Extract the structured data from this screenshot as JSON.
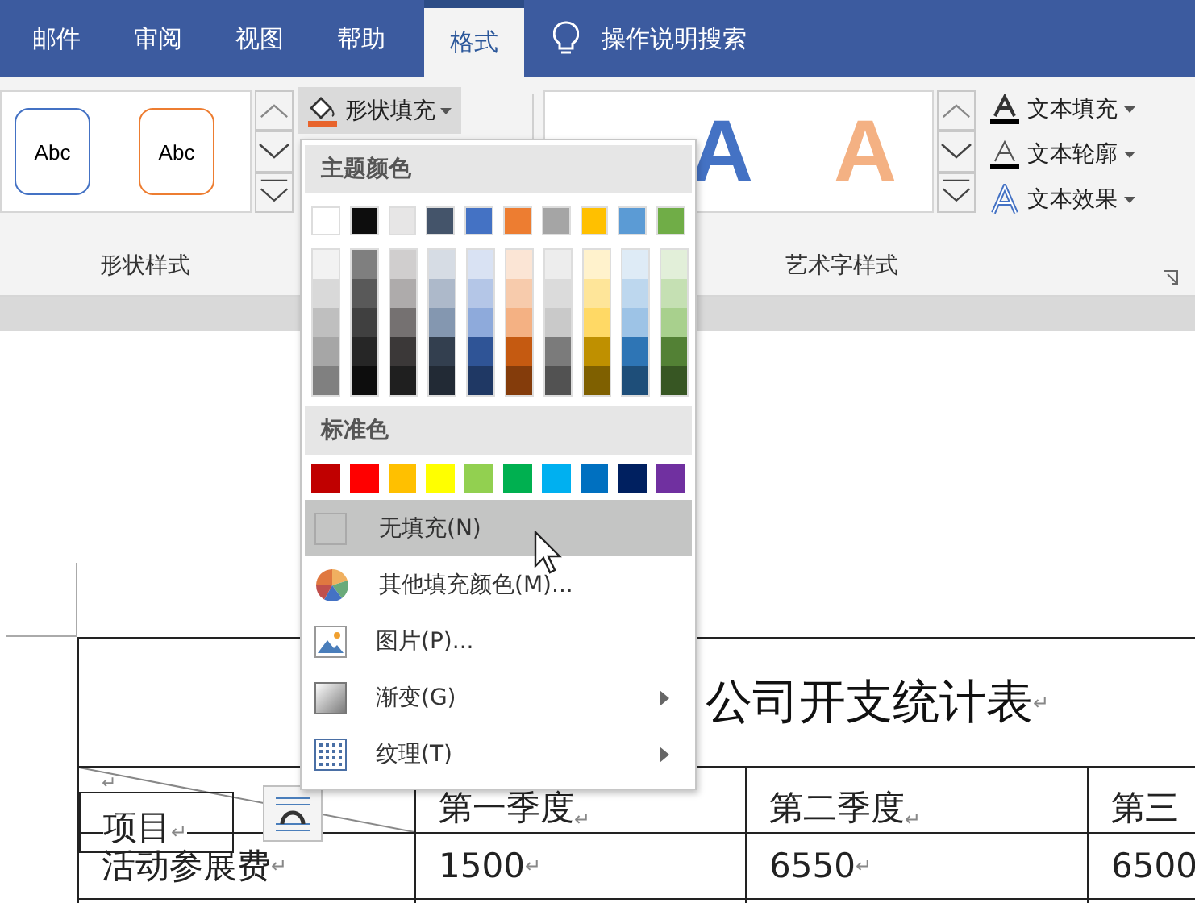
{
  "tabs": [
    {
      "label": "邮件",
      "selected": false
    },
    {
      "label": "审阅",
      "selected": false
    },
    {
      "label": "视图",
      "selected": false
    },
    {
      "label": "帮助",
      "selected": false
    },
    {
      "label": "格式",
      "selected": true
    }
  ],
  "search": {
    "label": "操作说明搜索"
  },
  "shape_styles": {
    "label": "形状样式",
    "styles": [
      {
        "text": "Abc",
        "color": "#4472c4"
      },
      {
        "text": "Abc",
        "color": "#ed7d31"
      }
    ],
    "fill_button": {
      "label": "形状填充"
    }
  },
  "wordart_styles": {
    "label": "艺术字样式",
    "samples": [
      {
        "text": "A",
        "color": "#4472c4"
      },
      {
        "text": "A",
        "color": "#f4b183"
      }
    ],
    "commands": [
      {
        "label": "文本填充",
        "kind": "fill"
      },
      {
        "label": "文本轮廓",
        "kind": "outline"
      },
      {
        "label": "文本效果",
        "kind": "effects"
      }
    ]
  },
  "fill_menu": {
    "theme_header": "主题颜色",
    "theme_colors": [
      {
        "color": "#ffffff",
        "shades": [
          {
            "color": "#f2f2f2"
          },
          {
            "color": "#d9d9d9"
          },
          {
            "color": "#bfbfbf"
          },
          {
            "color": "#a6a6a6"
          },
          {
            "color": "#808080"
          }
        ]
      },
      {
        "color": "#0d0d0d",
        "shades": [
          {
            "color": "#7f7f7f"
          },
          {
            "color": "#595959"
          },
          {
            "color": "#404040"
          },
          {
            "color": "#262626"
          },
          {
            "color": "#0d0d0d"
          }
        ]
      },
      {
        "color": "#e7e6e6",
        "shades": [
          {
            "color": "#d0cece"
          },
          {
            "color": "#aeabab"
          },
          {
            "color": "#757171"
          },
          {
            "color": "#3b3838"
          },
          {
            "color": "#1f1f1f"
          }
        ]
      },
      {
        "color": "#44546a",
        "shades": [
          {
            "color": "#d6dce4"
          },
          {
            "color": "#adb9ca"
          },
          {
            "color": "#8497b0"
          },
          {
            "color": "#333f4f"
          },
          {
            "color": "#222a35"
          }
        ]
      },
      {
        "color": "#4472c4",
        "shades": [
          {
            "color": "#d9e2f3"
          },
          {
            "color": "#b4c6e7"
          },
          {
            "color": "#8eaadb"
          },
          {
            "color": "#2f5496"
          },
          {
            "color": "#1f3864"
          }
        ]
      },
      {
        "color": "#ed7d31",
        "shades": [
          {
            "color": "#fbe5d5"
          },
          {
            "color": "#f7cbac"
          },
          {
            "color": "#f4b183"
          },
          {
            "color": "#c55a11"
          },
          {
            "color": "#843c0b"
          }
        ]
      },
      {
        "color": "#a5a5a5",
        "shades": [
          {
            "color": "#ededed"
          },
          {
            "color": "#dbdbdb"
          },
          {
            "color": "#c9c9c9"
          },
          {
            "color": "#7b7b7b"
          },
          {
            "color": "#525252"
          }
        ]
      },
      {
        "color": "#ffc000",
        "shades": [
          {
            "color": "#fff2cc"
          },
          {
            "color": "#fee599"
          },
          {
            "color": "#ffd965"
          },
          {
            "color": "#bf9000"
          },
          {
            "color": "#7f6000"
          }
        ]
      },
      {
        "color": "#5b9bd5",
        "shades": [
          {
            "color": "#deebf6"
          },
          {
            "color": "#bdd7ee"
          },
          {
            "color": "#9dc3e6"
          },
          {
            "color": "#2e75b5"
          },
          {
            "color": "#1e4e79"
          }
        ]
      },
      {
        "color": "#70ad47",
        "shades": [
          {
            "color": "#e2efd9"
          },
          {
            "color": "#c5e0b3"
          },
          {
            "color": "#a8d08d"
          },
          {
            "color": "#538135"
          },
          {
            "color": "#375623"
          }
        ]
      }
    ],
    "standard_header": "标准色",
    "standard_colors": [
      {
        "color": "#c00000"
      },
      {
        "color": "#ff0000"
      },
      {
        "color": "#ffc000"
      },
      {
        "color": "#ffff00"
      },
      {
        "color": "#92d050"
      },
      {
        "color": "#00b050"
      },
      {
        "color": "#00b0f0"
      },
      {
        "color": "#0070c0"
      },
      {
        "color": "#002060"
      },
      {
        "color": "#7030a0"
      }
    ],
    "items": [
      {
        "kind": "no-fill",
        "label": "无填充(N)",
        "highlighted": true,
        "submenu": false
      },
      {
        "kind": "more-colors",
        "label": "其他填充颜色(M)...",
        "highlighted": false,
        "submenu": false
      },
      {
        "kind": "picture",
        "label": "图片(P)...",
        "highlighted": false,
        "submenu": false
      },
      {
        "kind": "gradient",
        "label": "渐变(G)",
        "highlighted": false,
        "submenu": true
      },
      {
        "kind": "texture",
        "label": "纹理(T)",
        "highlighted": false,
        "submenu": true
      }
    ]
  },
  "document": {
    "title": {
      "text": "公司开支统计表",
      "mark": "↵"
    },
    "rows": [
      [
        {
          "mark": "↵",
          "diagonal": true
        },
        {
          "text": "第一季度",
          "mark": "↵"
        },
        {
          "text": "第二季度",
          "mark": "↵"
        },
        {
          "text": "第三"
        }
      ],
      [
        {
          "text": "活动参展费",
          "mark": "↵"
        },
        {
          "text": "1500",
          "mark": "↵"
        },
        {
          "text": "6550",
          "mark": "↵"
        },
        {
          "text": "6500"
        }
      ]
    ],
    "text_box": {
      "text": "项目",
      "mark": "↵"
    }
  }
}
